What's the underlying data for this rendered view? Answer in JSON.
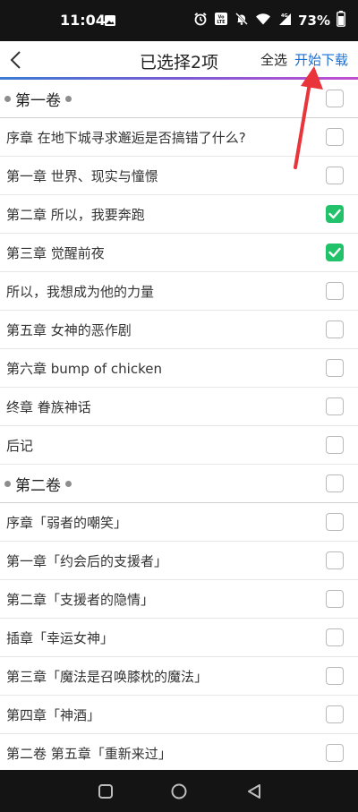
{
  "status_bar": {
    "time": "11:04",
    "battery": "73%"
  },
  "header": {
    "title": "已选择2项",
    "select_all": "全选",
    "start_download": "开始下载"
  },
  "rows": [
    {
      "type": "volume",
      "label": "第一卷",
      "checked": false
    },
    {
      "type": "chapter",
      "label": "序章 在地下城寻求邂逅是否搞错了什么?",
      "checked": false
    },
    {
      "type": "chapter",
      "label": "第一章 世界、现实与憧憬",
      "checked": false
    },
    {
      "type": "chapter",
      "label": "第二章 所以，我要奔跑",
      "checked": true
    },
    {
      "type": "chapter",
      "label": "第三章 觉醒前夜",
      "checked": true
    },
    {
      "type": "chapter",
      "label": "所以，我想成为他的力量",
      "checked": false
    },
    {
      "type": "chapter",
      "label": "第五章 女神的恶作剧",
      "checked": false
    },
    {
      "type": "chapter",
      "label": "第六章 bump of chicken",
      "checked": false
    },
    {
      "type": "chapter",
      "label": "终章 眷族神话",
      "checked": false
    },
    {
      "type": "chapter",
      "label": "后记",
      "checked": false
    },
    {
      "type": "volume",
      "label": "第二卷",
      "checked": false
    },
    {
      "type": "chapter",
      "label": "序章「弱者的嘲笑」",
      "checked": false
    },
    {
      "type": "chapter",
      "label": "第一章「约会后的支援者」",
      "checked": false
    },
    {
      "type": "chapter",
      "label": "第二章「支援者的隐情」",
      "checked": false
    },
    {
      "type": "chapter",
      "label": "插章「幸运女神」",
      "checked": false
    },
    {
      "type": "chapter",
      "label": "第三章「魔法是召唤膝枕的魔法」",
      "checked": false
    },
    {
      "type": "chapter",
      "label": "第四章「神酒」",
      "checked": false
    },
    {
      "type": "chapter",
      "label": "第二卷 第五章「重新来过」",
      "checked": false
    }
  ],
  "colors": {
    "accent": "#1a6fd6",
    "checkbox_checked": "#22c26a",
    "annotation_arrow": "#e8343a"
  }
}
